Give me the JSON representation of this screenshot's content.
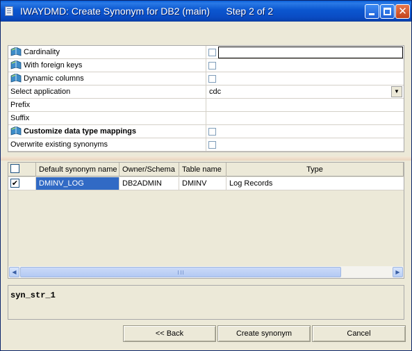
{
  "window": {
    "title": "IWAYDMD: Create Synonym for DB2 (main)      Step 2 of 2"
  },
  "properties": [
    {
      "label": "Cardinality",
      "icon": "book-icon",
      "bold": false,
      "control": "checkbox-text",
      "value": ""
    },
    {
      "label": "With foreign keys",
      "icon": "book-icon",
      "bold": false,
      "control": "checkbox",
      "value": ""
    },
    {
      "label": "Dynamic columns",
      "icon": "book-icon",
      "bold": false,
      "control": "checkbox",
      "value": ""
    },
    {
      "label": "Select application",
      "icon": "",
      "bold": false,
      "control": "dropdown",
      "value": "cdc"
    },
    {
      "label": "Prefix",
      "icon": "",
      "bold": false,
      "control": "text",
      "value": ""
    },
    {
      "label": "Suffix",
      "icon": "",
      "bold": false,
      "control": "text",
      "value": ""
    },
    {
      "label": "Customize data type mappings",
      "icon": "book-icon",
      "bold": true,
      "control": "checkbox",
      "value": ""
    },
    {
      "label": "Overwrite existing synonyms",
      "icon": "",
      "bold": false,
      "control": "checkbox",
      "value": ""
    }
  ],
  "table": {
    "columns": [
      "Default synonym name",
      "Owner/Schema",
      "Table name",
      "Type"
    ],
    "rows": [
      {
        "checked": true,
        "synonym": "DMINV_LOG",
        "owner": "DB2ADMIN",
        "table": "DMINV",
        "type": "Log Records"
      }
    ]
  },
  "status": {
    "text": "syn_str_1"
  },
  "buttons": {
    "back": "<< Back",
    "create": "Create synonym",
    "cancel": "Cancel"
  },
  "icons": {
    "checkmark": "✔",
    "dropdown": "▼",
    "scroll_left": "◀",
    "scroll_right": "▶",
    "close": "✕"
  }
}
